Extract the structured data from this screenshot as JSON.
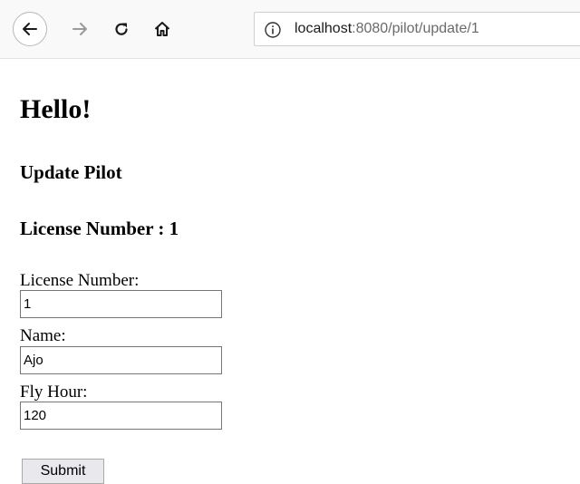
{
  "browser": {
    "url_host": "localhost",
    "url_rest": ":8080/pilot/update/1"
  },
  "page": {
    "greeting": "Hello!",
    "subtitle": "Update Pilot",
    "license_heading": "License Number : 1"
  },
  "form": {
    "license_label": "License Number:",
    "license_value": "1",
    "name_label": "Name:",
    "name_value": "Ajo",
    "fly_hour_label": "Fly Hour:",
    "fly_hour_value": "120",
    "submit_label": "Submit"
  }
}
